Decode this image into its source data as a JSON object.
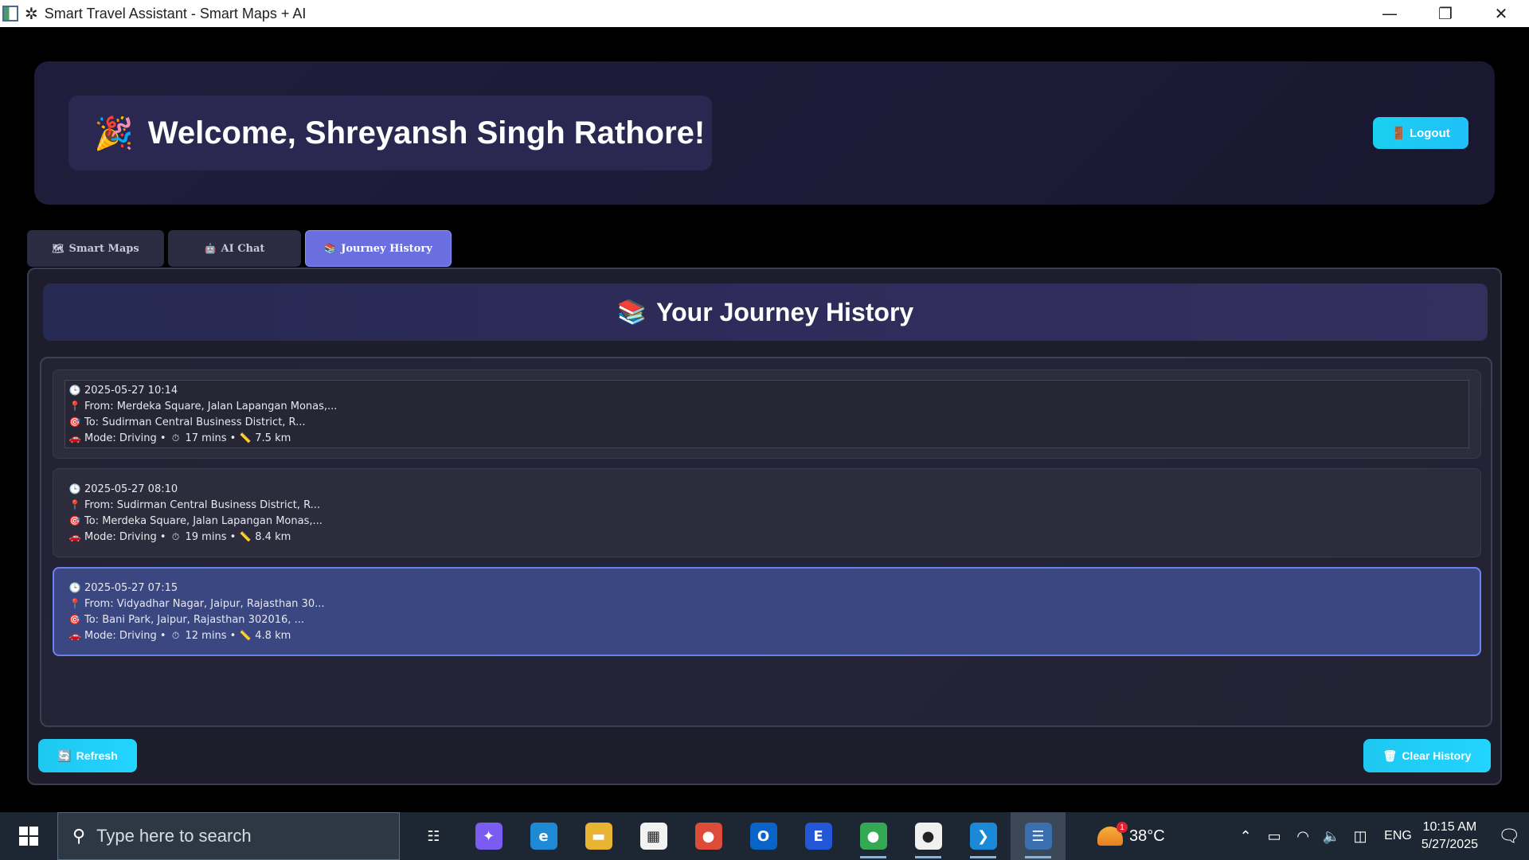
{
  "window": {
    "title": "Smart Travel Assistant - Smart Maps + AI",
    "minimize": "—",
    "restore": "❐",
    "close": "✕"
  },
  "header": {
    "welcome_emoji": "🎉",
    "welcome_text": "Welcome, Shreyansh Singh Rathore!",
    "logout_icon": "🚪",
    "logout_label": "Logout"
  },
  "tabs": [
    {
      "icon": "🗺",
      "label": "Smart Maps",
      "active": false
    },
    {
      "icon": "🤖",
      "label": "AI Chat",
      "active": false
    },
    {
      "icon": "📚",
      "label": "Journey History",
      "active": true
    }
  ],
  "history": {
    "title_emoji": "📚",
    "title": "Your Journey History",
    "icons": {
      "time": "🕒",
      "from": "📍",
      "to": "🎯",
      "mode": "🚗",
      "duration": "⏱",
      "distance": "📏"
    },
    "entries": [
      {
        "timestamp": "2025-05-27 10:14",
        "from": "From: Merdeka Square, Jalan Lapangan Monas,...",
        "to": "To: Sudirman Central Business District, R...",
        "mode": "Mode: Driving •",
        "duration": "17 mins •",
        "distance": "7.5 km"
      },
      {
        "timestamp": "2025-05-27 08:10",
        "from": "From: Sudirman Central Business District, R...",
        "to": "To: Merdeka Square, Jalan Lapangan Monas,...",
        "mode": "Mode: Driving •",
        "duration": "19 mins •",
        "distance": "8.4 km"
      },
      {
        "timestamp": "2025-05-27 07:15",
        "from": "From: Vidyadhar Nagar, Jaipur, Rajasthan 30...",
        "to": "To: Bani Park, Jaipur, Rajasthan 302016, ...",
        "mode": "Mode: Driving •",
        "duration": "12 mins •",
        "distance": "4.8 km"
      }
    ],
    "refresh_icon": "🔄",
    "refresh_label": "Refresh",
    "clear_icon": "🗑",
    "clear_label": "Clear History"
  },
  "taskbar": {
    "search_placeholder": "Type here to search",
    "apps": [
      {
        "name": "task-view",
        "glyph": "☷",
        "color": "#1c2733"
      },
      {
        "name": "copilot",
        "glyph": "✦",
        "color": "#7a5cf0"
      },
      {
        "name": "edge",
        "glyph": "e",
        "color": "#1e8ad6"
      },
      {
        "name": "file-explorer",
        "glyph": "▬",
        "color": "#e8b431"
      },
      {
        "name": "microsoft-store",
        "glyph": "▦",
        "color": "#f2f2f2"
      },
      {
        "name": "chrome",
        "glyph": "●",
        "color": "#dd4b39"
      },
      {
        "name": "outlook",
        "glyph": "O",
        "color": "#0a64c8"
      },
      {
        "name": "app-e",
        "glyph": "E",
        "color": "#2456d8"
      },
      {
        "name": "chrome-profile",
        "glyph": "●",
        "color": "#34a853"
      },
      {
        "name": "github",
        "glyph": "●",
        "color": "#f0f0f0"
      },
      {
        "name": "vscode",
        "glyph": "❯",
        "color": "#1a8ad8"
      },
      {
        "name": "python",
        "glyph": "☰",
        "color": "#3a6fb0"
      }
    ],
    "weather_badge": "1",
    "temperature": "38°C",
    "language": "ENG",
    "time": "10:15 AM",
    "date": "5/27/2025"
  }
}
